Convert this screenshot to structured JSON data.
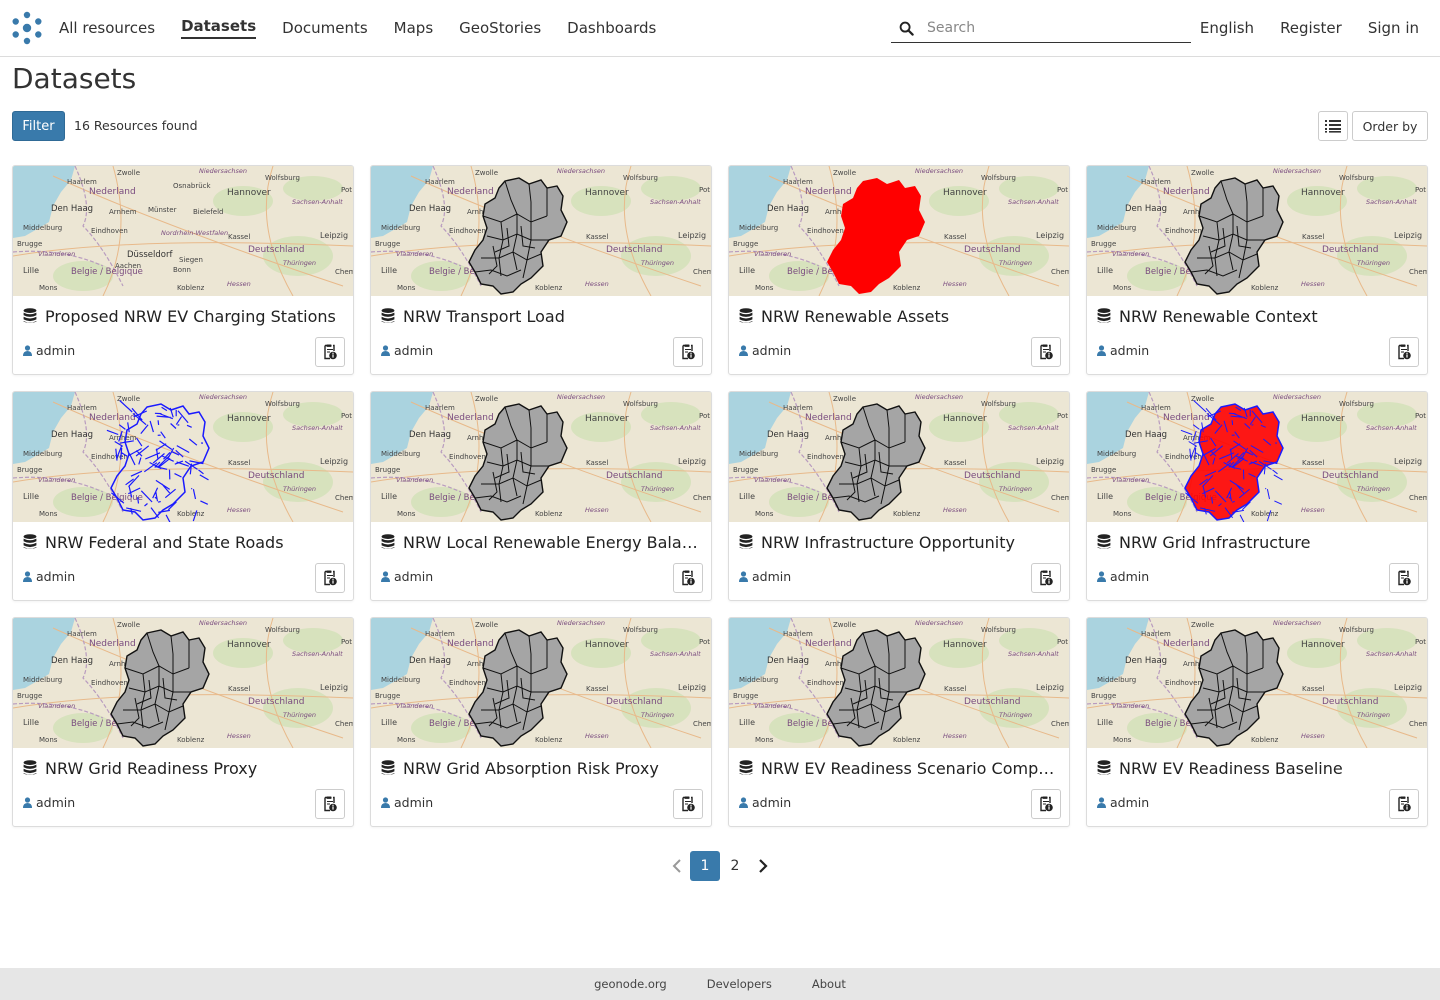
{
  "nav": {
    "items": [
      {
        "label": "All resources",
        "active": false
      },
      {
        "label": "Datasets",
        "active": true
      },
      {
        "label": "Documents",
        "active": false
      },
      {
        "label": "Maps",
        "active": false
      },
      {
        "label": "GeoStories",
        "active": false
      },
      {
        "label": "Dashboards",
        "active": false
      }
    ],
    "search_placeholder": "Search",
    "language": "English",
    "register": "Register",
    "sign_in": "Sign in"
  },
  "page": {
    "title": "Datasets",
    "filter_label": "Filter",
    "resources_found": "16 Resources found",
    "order_by": "Order by"
  },
  "cards": [
    {
      "title": "Proposed NRW EV Charging Stations",
      "owner": "admin",
      "overlay": "none"
    },
    {
      "title": "NRW Transport Load",
      "owner": "admin",
      "overlay": "gray"
    },
    {
      "title": "NRW Renewable Assets",
      "owner": "admin",
      "overlay": "red"
    },
    {
      "title": "NRW Renewable Context",
      "owner": "admin",
      "overlay": "gray"
    },
    {
      "title": "NRW Federal and State Roads",
      "owner": "admin",
      "overlay": "blue"
    },
    {
      "title": "NRW Local Renewable Energy Balance",
      "owner": "admin",
      "overlay": "gray"
    },
    {
      "title": "NRW Infrastructure Opportunity",
      "owner": "admin",
      "overlay": "gray"
    },
    {
      "title": "NRW Grid Infrastructure",
      "owner": "admin",
      "overlay": "redblue"
    },
    {
      "title": "NRW Grid Readiness Proxy",
      "owner": "admin",
      "overlay": "gray"
    },
    {
      "title": "NRW Grid Absorption Risk Proxy",
      "owner": "admin",
      "overlay": "gray"
    },
    {
      "title": "NRW EV Readiness Scenario Comparison",
      "owner": "admin",
      "overlay": "gray"
    },
    {
      "title": "NRW EV Readiness Baseline",
      "owner": "admin",
      "overlay": "gray"
    }
  ],
  "map_labels": [
    "Zwolle",
    "Haarlem",
    "Nederland",
    "Hannover",
    "Wolfsburg",
    "Den Haag",
    "Arnhem",
    "Middelburg",
    "Eindhoven",
    "Deutschland",
    "Leipzig",
    "Kassel",
    "Brugge",
    "Vlaanderen",
    "Lille",
    "Belgie / Belgique",
    "Mons",
    "Koblenz",
    "Hessen",
    "Thüringen",
    "Sachsen-Anhalt",
    "Niedersachsen",
    "Düsseldorf",
    "Osnabrück",
    "Münster",
    "Bielefeld",
    "Siegen",
    "Aachen",
    "Bonn",
    "Nordrhein-Westfalen",
    "Pot",
    "Chem"
  ],
  "pagination": {
    "pages": [
      "1",
      "2"
    ],
    "current": "1"
  },
  "footer": {
    "links": [
      "geonode.org",
      "Developers",
      "About"
    ]
  },
  "colors": {
    "primary": "#397aab",
    "region_gray": "#a5a5a5",
    "region_red": "#ff0000",
    "roads_blue": "#1a1aff"
  },
  "icons": {
    "logo": "geonode-logo-icon",
    "search": "search-icon",
    "dataset": "database-icon",
    "owner": "user-icon",
    "info": "info-icon",
    "list": "list-view-icon",
    "prev": "chevron-left-icon",
    "next": "chevron-right-icon"
  }
}
